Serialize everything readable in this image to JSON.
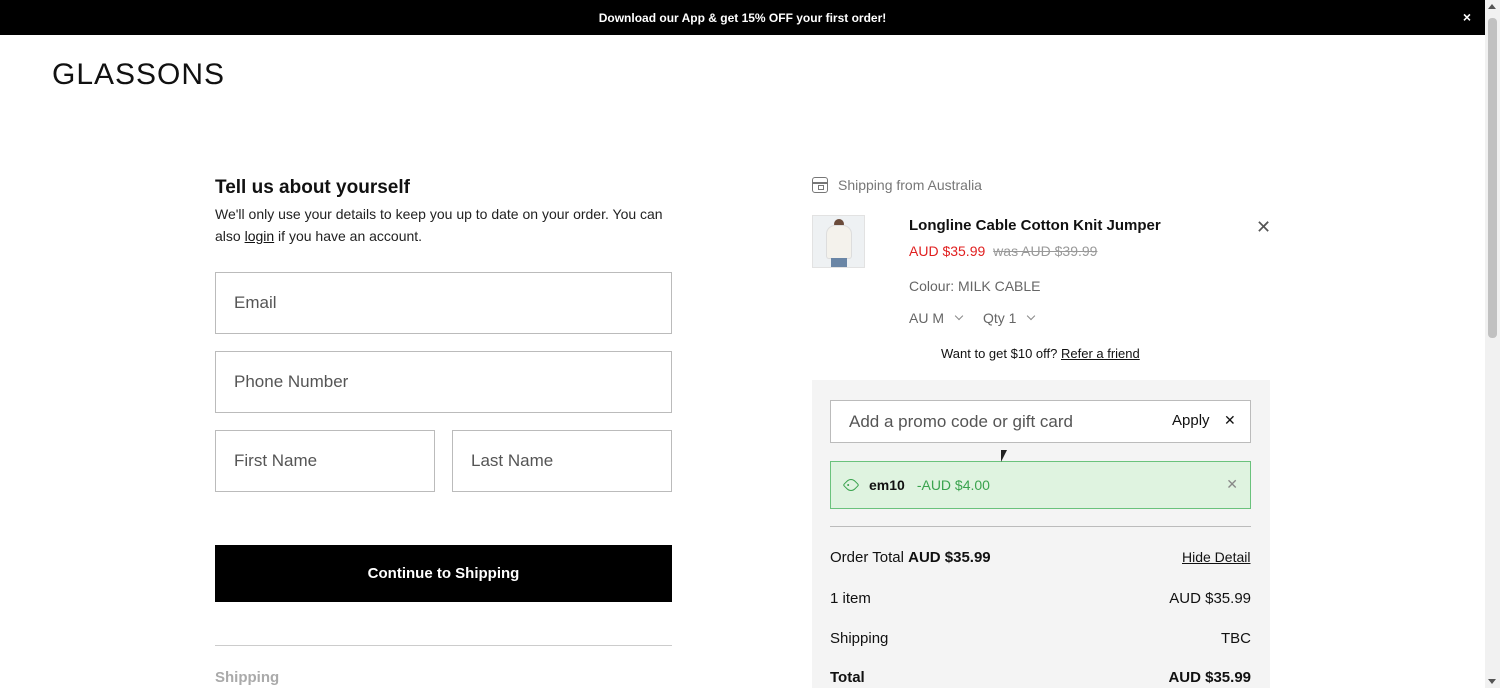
{
  "banner": {
    "text": "Download our App & get 15% OFF your first order!",
    "close": "×"
  },
  "brand": {
    "logo": "GLASSONS"
  },
  "form": {
    "title": "Tell us about yourself",
    "subtitle_before": "We'll only use your details to keep you up to date on your order. You can also ",
    "login_link": "login",
    "subtitle_after": " if you have an account.",
    "email_placeholder": "Email",
    "phone_placeholder": "Phone Number",
    "first_name_placeholder": "First Name",
    "last_name_placeholder": "Last Name",
    "continue_label": "Continue to Shipping",
    "next_step": "Shipping"
  },
  "cart": {
    "shipping_from": "Shipping from Australia",
    "item": {
      "name": "Longline Cable Cotton Knit Jumper",
      "price": "AUD $35.99",
      "was_price": "was AUD $39.99",
      "colour": "Colour: MILK CABLE",
      "size": "AU M",
      "qty": "Qty 1",
      "remove": "✕"
    },
    "refer_text": "Want to get $10 off? ",
    "refer_link": "Refer a friend"
  },
  "promo": {
    "placeholder": "Add a promo code or gift card",
    "apply": "Apply",
    "clear": "✕",
    "applied_code": "em10",
    "applied_discount": "-AUD $4.00",
    "applied_remove": "✕"
  },
  "summary": {
    "order_total_label": "Order Total",
    "order_total_value": "AUD $35.99",
    "hide_detail": "Hide Detail",
    "rows": [
      {
        "label": "1 item",
        "value": "AUD $35.99"
      },
      {
        "label": "Shipping",
        "value": "TBC"
      },
      {
        "label": "Total",
        "value": "AUD $35.99"
      }
    ]
  },
  "colors": {
    "accent": "#000000",
    "sale_red": "#e02020",
    "success_green": "#3aa34e",
    "panel_bg": "#f4f4f4"
  }
}
